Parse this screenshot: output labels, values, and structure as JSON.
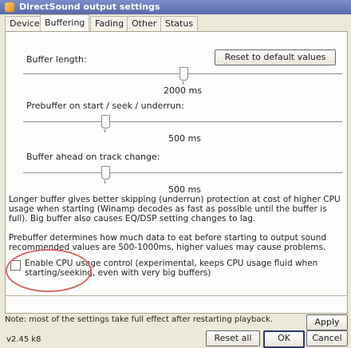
{
  "window": {
    "title": "DirectSound output settings"
  },
  "tabs": [
    {
      "label": "Device"
    },
    {
      "label": "Buffering"
    },
    {
      "label": "Fading"
    },
    {
      "label": "Other"
    },
    {
      "label": "Status"
    }
  ],
  "buffering": {
    "reset_label": "Reset to default values",
    "buffer_length": {
      "label": "Buffer length:",
      "value_text": "2000 ms",
      "level": 0.5
    },
    "prebuffer": {
      "label": "Prebuffer on start / seek / underrun:",
      "value_text": "500 ms",
      "level": 0.25
    },
    "buffer_ahead": {
      "label": "Buffer ahead on track change:",
      "value_text": "500 ms",
      "level": 0.25
    },
    "info1": "Longer buffer gives better skipping (underrun) protection at cost of higher CPU usage when starting (Winamp decodes as fast as possible until the buffer is full). Big buffer also causes EQ/DSP setting changes to lag.",
    "info2": "Prebuffer determines how much data to eat before starting to output sound recommended values are 500-1000ms, higher values may cause problems.",
    "cpu_control": {
      "label": "Enable CPU usage control (experimental, keeps CPU usage fluid when starting/seeking, even with very big buffers)",
      "checked": false
    }
  },
  "footer": {
    "note": "Note: most of the settings take full effect after restarting playback.",
    "apply_label": "Apply",
    "version": "v2.45 k8",
    "reset_all_label": "Reset all",
    "ok_label": "OK",
    "cancel_label": "Cancel"
  },
  "colors": {
    "titlebar": "#5a6aa9",
    "panel": "#fdfdfb",
    "dialog": "#ece9d8",
    "annotation": "#d66a6a"
  }
}
